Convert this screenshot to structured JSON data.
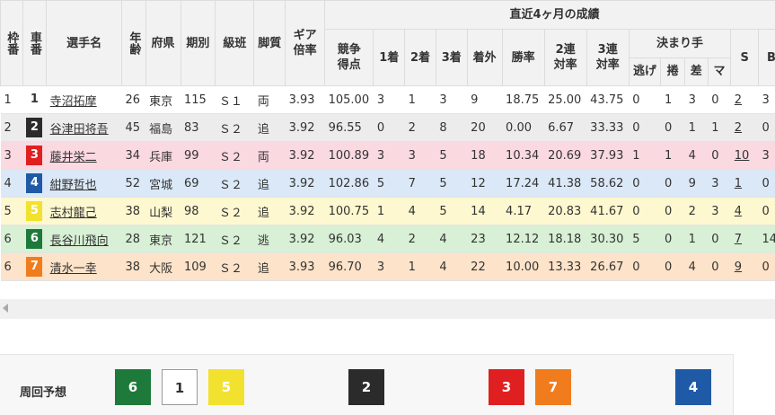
{
  "headers": {
    "waku": "枠番",
    "car": "車番",
    "name": "選手名",
    "age": "年齢",
    "pref": "府県",
    "term": "期別",
    "class": "級班",
    "style": "脚質",
    "gear": "ギア倍率",
    "recent": "直近4ヶ月の成績",
    "score": "競争得点",
    "first": "1着",
    "second": "2着",
    "third": "3着",
    "out": "着外",
    "winrate": "勝率",
    "rate2": "2連対率",
    "rate3": "3連対率",
    "kimarite": "決まり手",
    "nige": "逃げ",
    "makuri": "捲",
    "sashi": "差",
    "mark": "マ",
    "s": "S",
    "b": "B"
  },
  "colors": {
    "car": {
      "1": {
        "bg": "#ffffff",
        "fg": "#333333"
      },
      "2": {
        "bg": "#2b2b2b",
        "fg": "#ffffff"
      },
      "3": {
        "bg": "#e02020",
        "fg": "#ffffff"
      },
      "4": {
        "bg": "#1f5aa6",
        "fg": "#ffffff"
      },
      "5": {
        "bg": "#f2e12e",
        "fg": "#ffffff"
      },
      "6": {
        "bg": "#1e7a3a",
        "fg": "#ffffff"
      },
      "7": {
        "bg": "#f07c1e",
        "fg": "#ffffff"
      }
    },
    "row": {
      "1": "#ffffff",
      "2": "#ececec",
      "3": "#fbd9e1",
      "4": "#dbe8f7",
      "5": "#fdf8cf",
      "6": "#d8f0d5",
      "7": "#fde3c9"
    }
  },
  "riders": [
    {
      "waku": "1",
      "car": "1",
      "name": "寺沼拓摩",
      "age": "26",
      "pref": "東京",
      "term": "115",
      "class": "Ｓ１",
      "style": "両",
      "gear": "3.93",
      "score": "105.00",
      "first": "3",
      "second": "1",
      "third": "3",
      "out": "9",
      "winrate": "18.75",
      "rate2": "25.00",
      "rate3": "43.75",
      "nige": "0",
      "makuri": "1",
      "sashi": "3",
      "mark": "0",
      "s": "2",
      "b": "3"
    },
    {
      "waku": "2",
      "car": "2",
      "name": "谷津田将吾",
      "age": "45",
      "pref": "福島",
      "term": "83",
      "class": "Ｓ２",
      "style": "追",
      "gear": "3.92",
      "score": "96.55",
      "first": "0",
      "second": "2",
      "third": "8",
      "out": "20",
      "winrate": "0.00",
      "rate2": "6.67",
      "rate3": "33.33",
      "nige": "0",
      "makuri": "0",
      "sashi": "1",
      "mark": "1",
      "s": "2",
      "b": "0"
    },
    {
      "waku": "3",
      "car": "3",
      "name": "藤井栄二",
      "age": "34",
      "pref": "兵庫",
      "term": "99",
      "class": "Ｓ２",
      "style": "両",
      "gear": "3.92",
      "score": "100.89",
      "first": "3",
      "second": "3",
      "third": "5",
      "out": "18",
      "winrate": "10.34",
      "rate2": "20.69",
      "rate3": "37.93",
      "nige": "1",
      "makuri": "1",
      "sashi": "4",
      "mark": "0",
      "s": "10",
      "b": "3"
    },
    {
      "waku": "4",
      "car": "4",
      "name": "紺野哲也",
      "age": "52",
      "pref": "宮城",
      "term": "69",
      "class": "Ｓ２",
      "style": "追",
      "gear": "3.92",
      "score": "102.86",
      "first": "5",
      "second": "7",
      "third": "5",
      "out": "12",
      "winrate": "17.24",
      "rate2": "41.38",
      "rate3": "58.62",
      "nige": "0",
      "makuri": "0",
      "sashi": "9",
      "mark": "3",
      "s": "1",
      "b": "0"
    },
    {
      "waku": "5",
      "car": "5",
      "name": "志村龍己",
      "age": "38",
      "pref": "山梨",
      "term": "98",
      "class": "Ｓ２",
      "style": "追",
      "gear": "3.92",
      "score": "100.75",
      "first": "1",
      "second": "4",
      "third": "5",
      "out": "14",
      "winrate": "4.17",
      "rate2": "20.83",
      "rate3": "41.67",
      "nige": "0",
      "makuri": "0",
      "sashi": "2",
      "mark": "3",
      "s": "4",
      "b": "0"
    },
    {
      "waku": "6",
      "car": "6",
      "name": "長谷川飛向",
      "age": "28",
      "pref": "東京",
      "term": "121",
      "class": "Ｓ２",
      "style": "逃",
      "gear": "3.92",
      "score": "96.03",
      "first": "4",
      "second": "2",
      "third": "4",
      "out": "23",
      "winrate": "12.12",
      "rate2": "18.18",
      "rate3": "30.30",
      "nige": "5",
      "makuri": "0",
      "sashi": "1",
      "mark": "0",
      "s": "7",
      "b": "14"
    },
    {
      "waku": "6",
      "car": "7",
      "name": "清水一幸",
      "age": "38",
      "pref": "大阪",
      "term": "109",
      "class": "Ｓ２",
      "style": "追",
      "gear": "3.93",
      "score": "96.70",
      "first": "3",
      "second": "1",
      "third": "4",
      "out": "22",
      "winrate": "10.00",
      "rate2": "13.33",
      "rate3": "26.67",
      "nige": "0",
      "makuri": "0",
      "sashi": "4",
      "mark": "0",
      "s": "9",
      "b": "0"
    }
  ],
  "prediction": {
    "label": "周回予想",
    "cars": [
      "6",
      "1",
      "5",
      "2",
      "3",
      "7",
      "4"
    ]
  }
}
